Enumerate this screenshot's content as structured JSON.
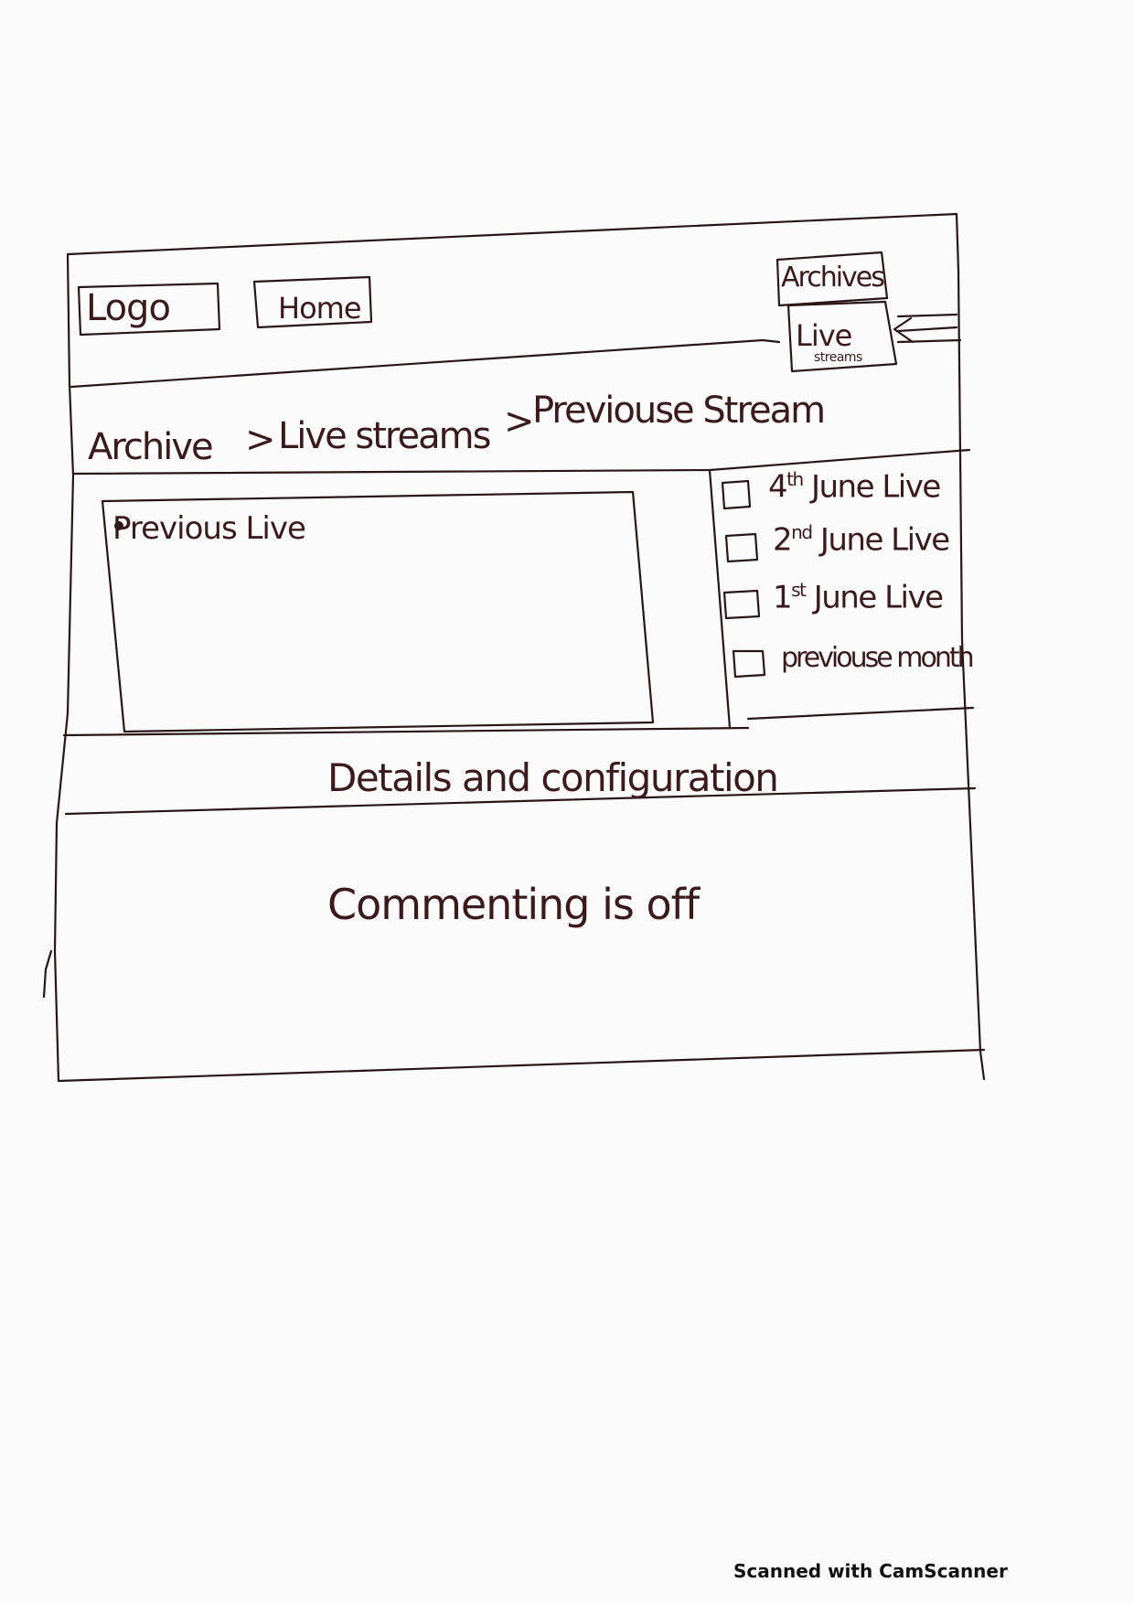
{
  "header": {
    "logo": "Logo",
    "home": "Home",
    "archives": "Archives",
    "live": "Live",
    "streams": "streams"
  },
  "breadcrumb": {
    "items": [
      "Archive",
      "Live streams",
      "Previouse Stream"
    ],
    "separator": ">"
  },
  "player": {
    "bullet_label": "Previous Live"
  },
  "sidebar": {
    "items": [
      {
        "day": "4",
        "suffix": "th",
        "label": "June Live"
      },
      {
        "day": "2",
        "suffix": "nd",
        "label": "June Live"
      },
      {
        "day": "1",
        "suffix": "st",
        "label": "June Live"
      },
      {
        "day": "",
        "suffix": "",
        "label": "previouse month"
      }
    ]
  },
  "details": {
    "title": "Details and configuration"
  },
  "comments": {
    "status": "Commenting is off"
  },
  "watermark": "Scanned with CamScanner",
  "colors": {
    "ink": "#2a1616",
    "paper": "#fbfbfb"
  }
}
